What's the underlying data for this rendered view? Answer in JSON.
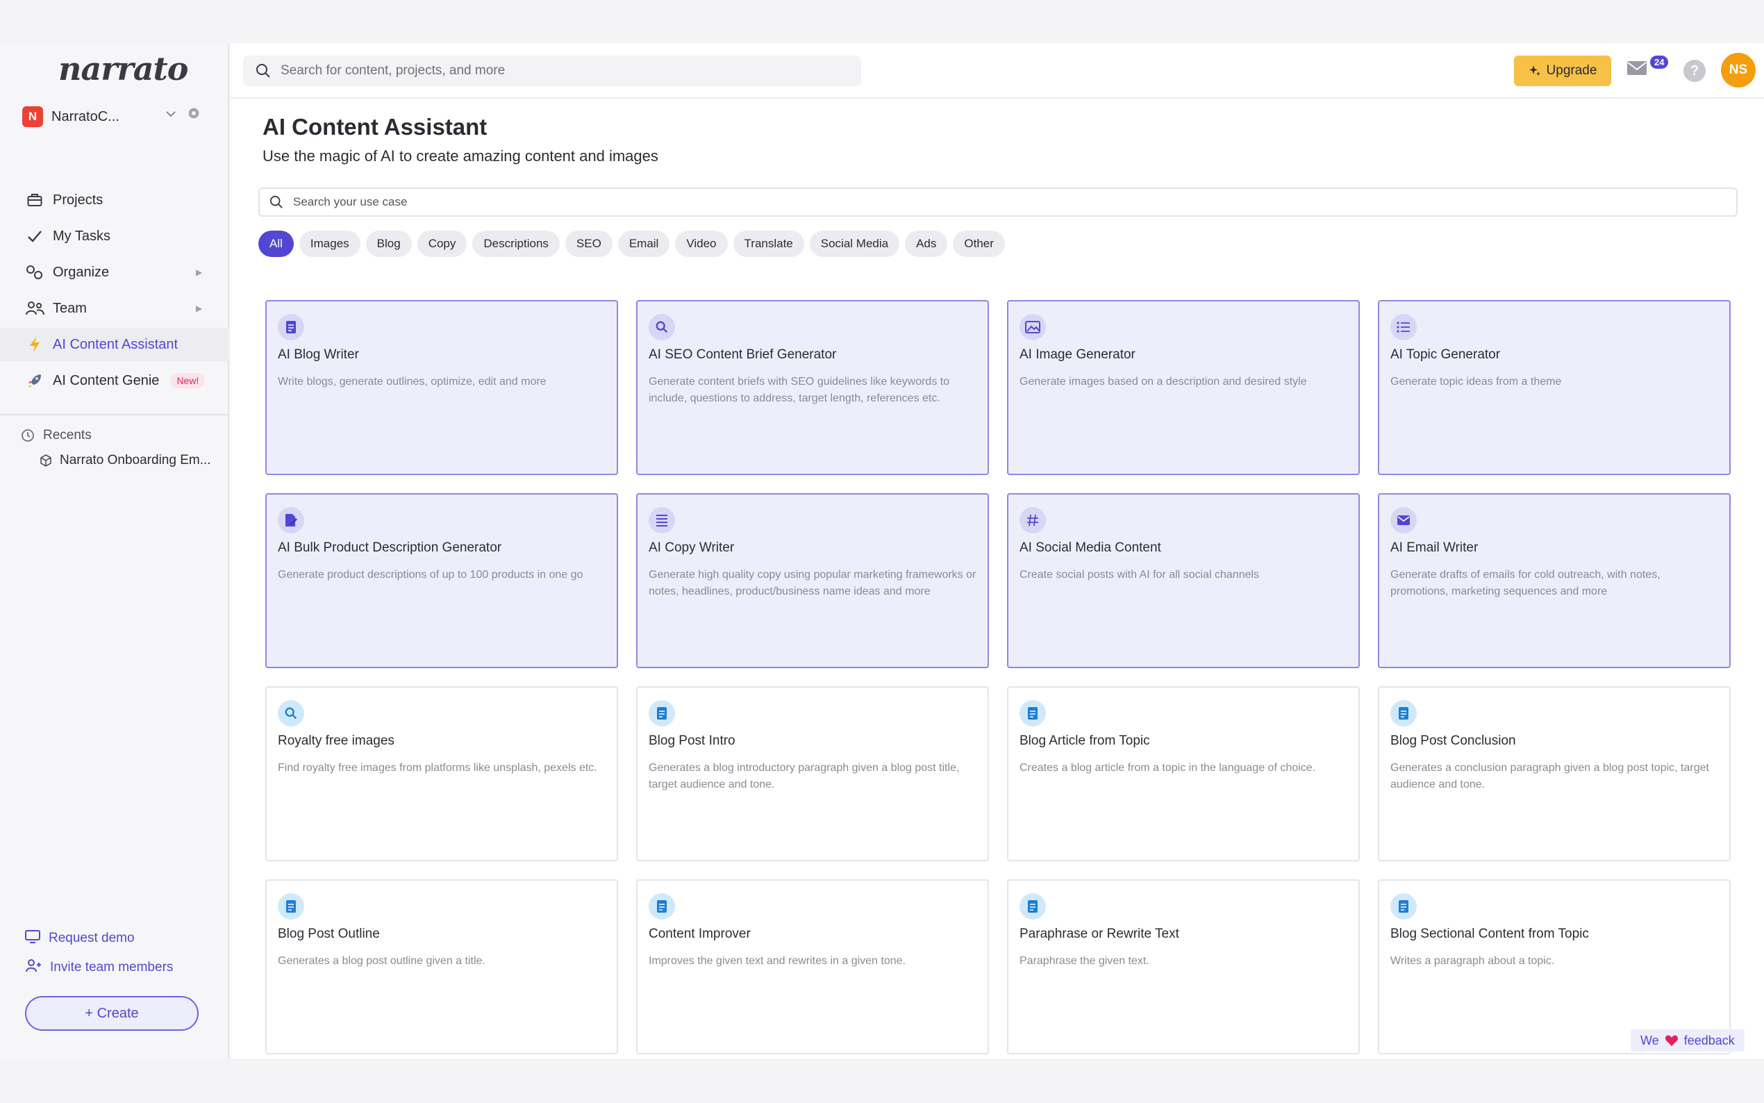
{
  "app": {
    "logo_text": "narrato"
  },
  "workspace": {
    "badge": "N",
    "name": "NarratoC..."
  },
  "sidebar": {
    "items": [
      {
        "label": "Projects"
      },
      {
        "label": "My Tasks"
      },
      {
        "label": "Organize"
      },
      {
        "label": "Team"
      },
      {
        "label": "AI Content Assistant"
      },
      {
        "label": "AI Content Genie",
        "badge": "New!"
      }
    ],
    "recents_label": "Recents",
    "recent_items": [
      {
        "label": "Narrato Onboarding Em..."
      }
    ],
    "request_demo": "Request demo",
    "invite": "Invite team members",
    "create": "+ Create"
  },
  "topbar": {
    "search_placeholder": "Search for content, projects, and more",
    "upgrade": "Upgrade",
    "mail_count": "24",
    "help": "?",
    "avatar": "NS"
  },
  "main": {
    "title": "AI Content Assistant",
    "subtitle": "Use the magic of AI to create amazing content and images",
    "search_placeholder": "Search your use case",
    "chips": [
      "All",
      "Images",
      "Blog",
      "Copy",
      "Descriptions",
      "SEO",
      "Email",
      "Video",
      "Translate",
      "Social Media",
      "Ads",
      "Other"
    ],
    "cards": [
      {
        "title": "AI Blog Writer",
        "desc": "Write blogs, generate outlines, optimize, edit and more",
        "icon": "document-icon"
      },
      {
        "title": "AI SEO Content Brief Generator",
        "desc": "Generate content briefs with SEO guidelines like keywords to include, questions to address, target length, references etc.",
        "icon": "search-icon"
      },
      {
        "title": "AI Image Generator",
        "desc": "Generate images based on a description and desired style",
        "icon": "image-icon"
      },
      {
        "title": "AI Topic Generator",
        "desc": "Generate topic ideas from a theme",
        "icon": "list-icon"
      },
      {
        "title": "AI Bulk Product Description Generator",
        "desc": "Generate product descriptions of up to 100 products in one go",
        "icon": "document-edit-icon"
      },
      {
        "title": "AI Copy Writer",
        "desc": "Generate high quality copy using popular marketing frameworks or notes, headlines, product/business name ideas and more",
        "icon": "lines-icon"
      },
      {
        "title": "AI Social Media Content",
        "desc": "Create social posts with AI for all social channels",
        "icon": "hashtag-icon"
      },
      {
        "title": "AI Email Writer",
        "desc": "Generate drafts of emails for cold outreach, with notes, promotions, marketing sequences and more",
        "icon": "mail-icon"
      },
      {
        "title": "Royalty free images",
        "desc": "Find royalty free images from platforms like unsplash, pexels etc.",
        "icon": "search-icon"
      },
      {
        "title": "Blog Post Intro",
        "desc": "Generates a blog introductory paragraph given a blog post title, target audience and tone.",
        "icon": "document-icon"
      },
      {
        "title": "Blog Article from Topic",
        "desc": "Creates a blog article from a topic in the language of choice.",
        "icon": "document-icon"
      },
      {
        "title": "Blog Post Conclusion",
        "desc": "Generates a conclusion paragraph given a blog post topic, target audience and tone.",
        "icon": "document-icon"
      },
      {
        "title": "Blog Post Outline",
        "desc": "Generates a blog post outline given a title.",
        "icon": "document-icon"
      },
      {
        "title": "Content Improver",
        "desc": "Improves the given text and rewrites in a given tone.",
        "icon": "document-icon"
      },
      {
        "title": "Paraphrase or Rewrite Text",
        "desc": "Paraphrase the given text.",
        "icon": "document-icon"
      },
      {
        "title": "Blog Sectional Content from Topic",
        "desc": "Writes a paragraph about a topic.",
        "icon": "document-icon"
      }
    ]
  },
  "feedback": {
    "pre": "We",
    "post": "feedback"
  },
  "colors": {
    "accent": "#5147d3",
    "upgrade": "#f7c046",
    "avatar": "#f59e0b",
    "ai_card_bg": "#eeeefb",
    "ai_card_border": "#8e88e3"
  }
}
